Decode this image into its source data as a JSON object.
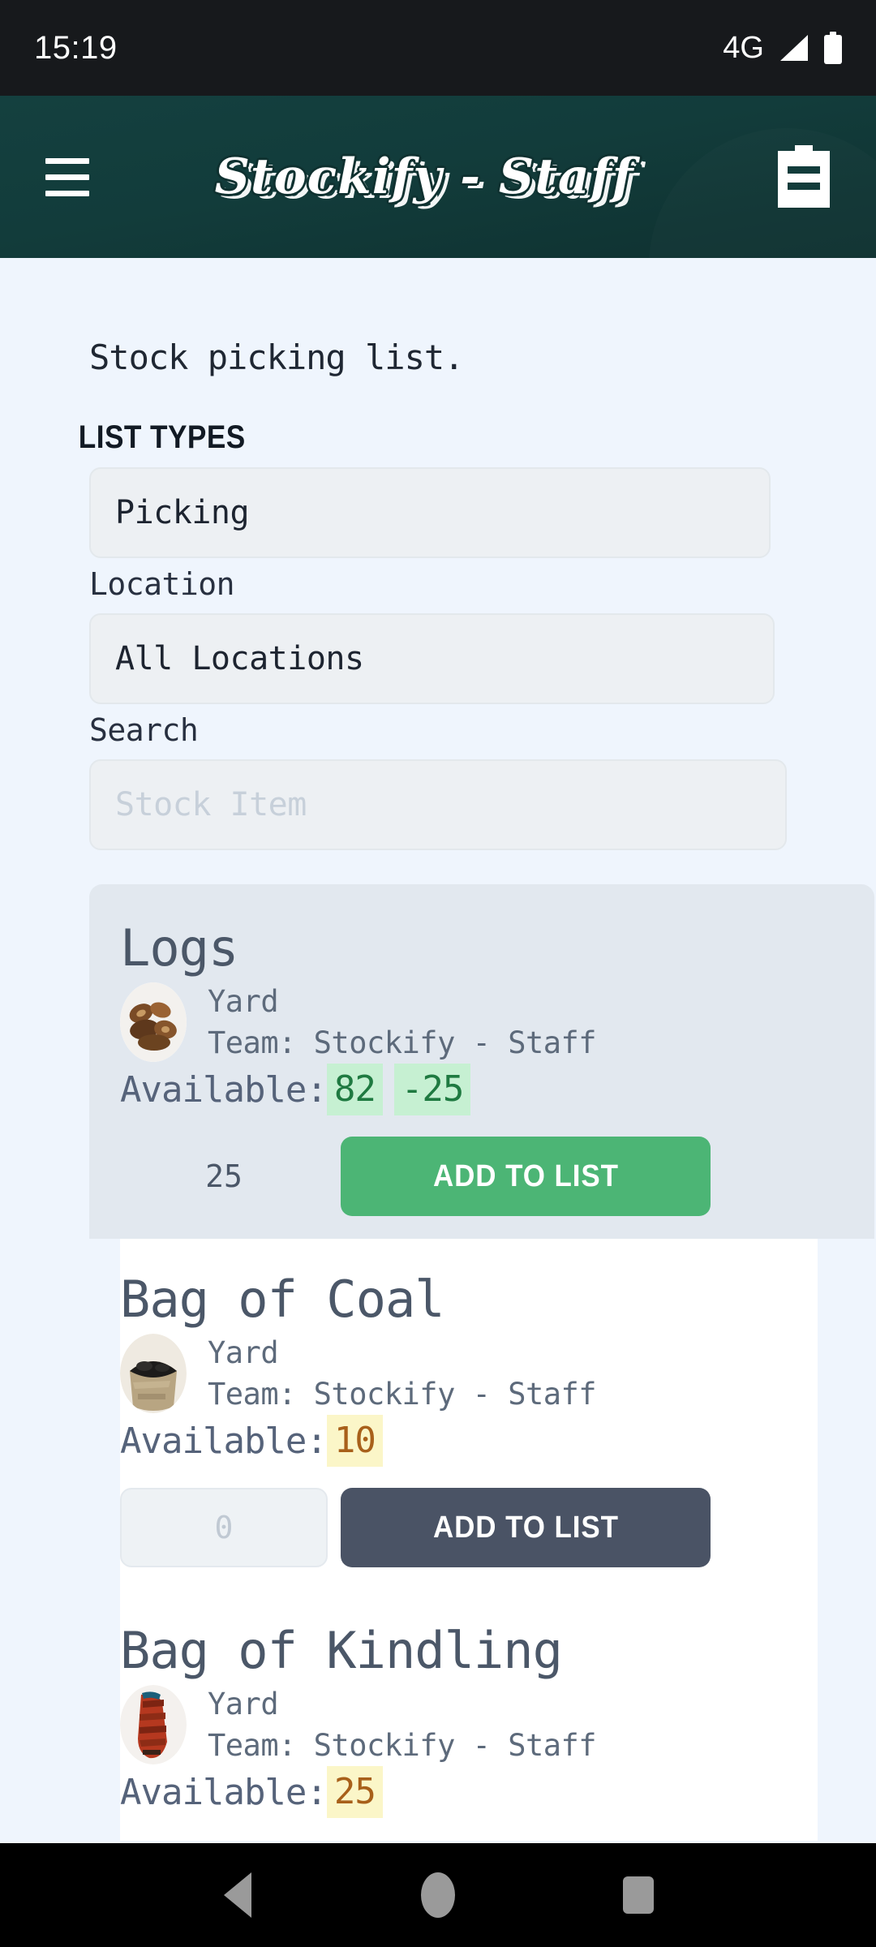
{
  "status_bar": {
    "time": "15:19",
    "network": "4G",
    "signal_icon": "signal-bars-icon",
    "battery_icon": "battery-full-icon"
  },
  "app_bar": {
    "menu_icon": "hamburger-menu-icon",
    "title": "Stockify - Staff",
    "clipboard_icon": "clipboard-icon",
    "background_color": "#123c3b"
  },
  "main": {
    "intro_text": "Stock picking list.",
    "list_types": {
      "label": "LIST TYPES",
      "value": "Picking"
    },
    "location": {
      "label": "Location",
      "value": "All Locations"
    },
    "search": {
      "label": "Search",
      "placeholder": "Stock Item",
      "value": ""
    },
    "items": [
      {
        "name": "Logs",
        "thumb_icon": "logs-photo",
        "location": "Yard",
        "team": "Team: Stockify - Staff",
        "available_label": "Available:",
        "available": "82",
        "adjustment": "-25",
        "badge_style": "green",
        "qty_value": "25",
        "qty_placeholder": "",
        "add_label": "ADD TO LIST",
        "add_style": "green",
        "selected": true
      },
      {
        "name": "Bag of Coal",
        "thumb_icon": "coal-photo",
        "location": "Yard",
        "team": "Team: Stockify - Staff",
        "available_label": "Available:",
        "available": "10",
        "adjustment": "",
        "badge_style": "yellow",
        "qty_value": "",
        "qty_placeholder": "0",
        "add_label": "ADD TO LIST",
        "add_style": "dark",
        "selected": false
      },
      {
        "name": "Bag of Kindling",
        "thumb_icon": "kindling-photo",
        "location": "Yard",
        "team": "Team: Stockify - Staff",
        "available_label": "Available:",
        "available": "25",
        "adjustment": "",
        "badge_style": "yellow",
        "qty_value": "",
        "qty_placeholder": "",
        "add_label": "",
        "add_style": "dark",
        "selected": false
      }
    ]
  },
  "nav_bar": {
    "back_icon": "back-triangle-icon",
    "home_icon": "home-circle-icon",
    "recents_icon": "recents-square-icon"
  },
  "colors": {
    "brand_dark": "#123c3b",
    "page_bg": "#eff5fd",
    "accent_green": "#4cb575",
    "accent_dark": "#4a5365",
    "badge_green_bg": "#c6f0d2",
    "badge_yellow_bg": "#fbf6c8"
  }
}
